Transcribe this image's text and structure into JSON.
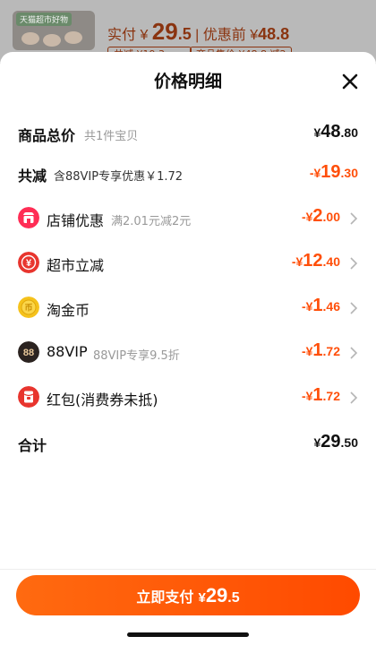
{
  "background": {
    "thumb_tag": "天猫超市好物",
    "paid_label": "实付 ¥ ",
    "paid_int": "29",
    "paid_dec": ".5",
    "before_label": " | 优惠前 ¥",
    "before_value": "48.8",
    "chip1": "共减 ¥19.3",
    "chip2": "商品售价 ¥48.8 减2"
  },
  "sheet": {
    "title": "价格明细",
    "total_row": {
      "label": "商品总价",
      "sub": "共1件宝贝",
      "currency": "¥",
      "int": "48",
      "dec": ".80"
    },
    "reduce_row": {
      "label": "共减",
      "sub": "含88VIP专享优惠￥1.72",
      "prefix": "-¥",
      "int": "19",
      "dec": ".30"
    },
    "discounts": [
      {
        "icon": "store-coupon-icon",
        "label": "店铺优惠",
        "sub": "满2.01元减2元",
        "prefix": "-¥",
        "int": "2",
        "dec": ".00"
      },
      {
        "icon": "supermarket-yuan-icon",
        "label": "超市立减",
        "sub": "",
        "prefix": "-¥",
        "int": "12",
        "dec": ".40"
      },
      {
        "icon": "gold-coin-icon",
        "label": "淘金币",
        "sub": "",
        "prefix": "-¥",
        "int": "1",
        "dec": ".46"
      },
      {
        "icon": "vip88-icon",
        "label": "88VIP",
        "sub": "88VIP专享9.5折",
        "prefix": "-¥",
        "int": "1",
        "dec": ".72"
      },
      {
        "icon": "red-packet-icon",
        "label": "红包(消费券未抵)",
        "sub": "",
        "prefix": "-¥",
        "int": "1",
        "dec": ".72"
      }
    ],
    "sum_row": {
      "label": "合计",
      "currency": "¥",
      "int": "29",
      "dec": ".50"
    },
    "pay_button": {
      "label": "立即支付",
      "currency": "¥",
      "int": "29",
      "dec": ".5"
    },
    "icon_glyphs": {
      "supermarket": "¥",
      "gold": "币",
      "vip": "88"
    }
  },
  "colors": {
    "accent": "#ff4f0a",
    "button": "#ff5a00",
    "store_icon": "#ff2d55",
    "supermarket_icon": "#e8352e",
    "gold_icon": "#f5c21c",
    "vip_icon": "#2b2320",
    "red_packet_icon": "#e8352e"
  }
}
